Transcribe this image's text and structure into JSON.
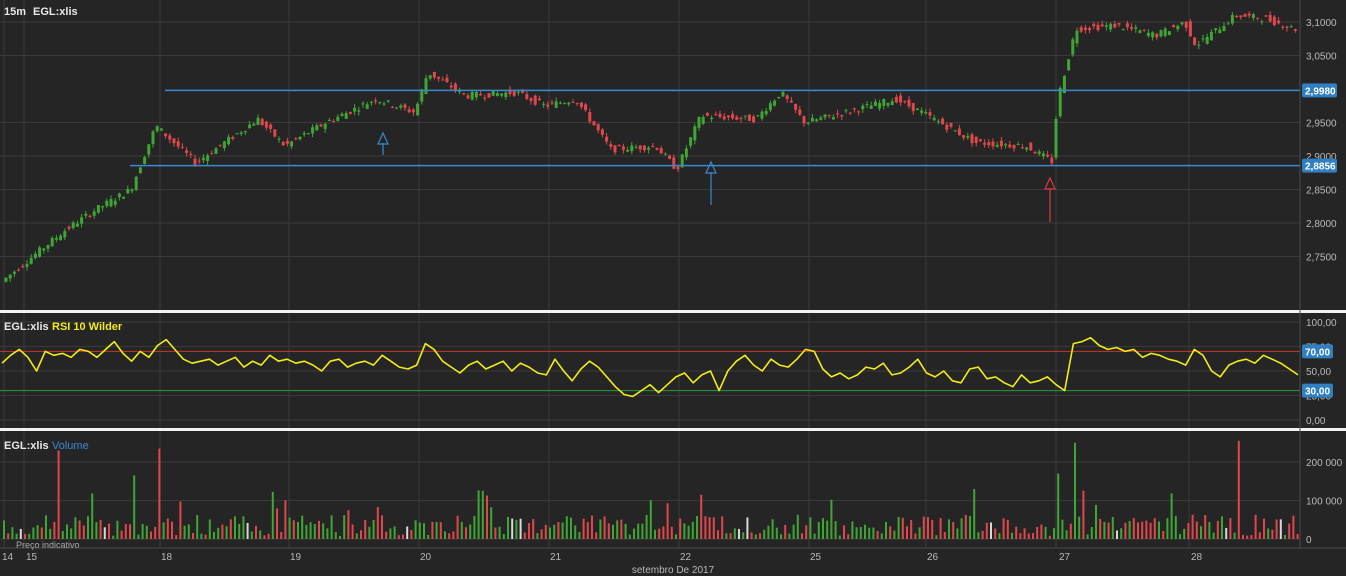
{
  "colors": {
    "background": "#252525",
    "grid": "#3a3a3a",
    "up": "#3fa535",
    "down": "#e0474c",
    "level_line": "#3a8ad0",
    "rsi_line": "#f2ec1a",
    "rsi_upper": "#c0392b",
    "rsi_lower": "#2e9a3a",
    "tag_bg": "#2f7fc1",
    "arrow_blue": "#3a8ad0",
    "arrow_red": "#d53a3a"
  },
  "header": {
    "interval": "15m",
    "symbol": "EGL:xlis"
  },
  "rsi_panel": {
    "symbol": "EGL:xlis",
    "indicator": "RSI 10 Wilder"
  },
  "volume_panel": {
    "symbol": "EGL:xlis",
    "indicator": "Volume"
  },
  "footer_note": "Preço indicativo",
  "x_axis": {
    "title": "setembro De 2017",
    "day_labels": [
      "14",
      "15",
      "18",
      "19",
      "20",
      "21",
      "22",
      "25",
      "26",
      "27",
      "28"
    ]
  },
  "price_axis": {
    "tick_labels": [
      "3,1000",
      "3,0500",
      "2,9500",
      "2,9000",
      "2,8500",
      "2,8000",
      "2,7500"
    ],
    "level_tags": [
      "2,9980",
      "2,8856"
    ]
  },
  "rsi_axis": {
    "tick_labels": [
      "100,00",
      "75,00",
      "50,00",
      "25,00",
      "0,00"
    ],
    "level_tags": [
      "70,00",
      "30,00"
    ]
  },
  "volume_axis": {
    "tick_labels": [
      "200 000",
      "100 000",
      "0"
    ]
  },
  "chart_data": [
    {
      "type": "candlestick",
      "title": "EGL:xlis 15m",
      "ylim": [
        2.7,
        3.12
      ],
      "yticks": [
        3.1,
        3.05,
        2.95,
        2.9,
        2.85,
        2.8,
        2.75
      ],
      "horizontal_levels": [
        2.998,
        2.8856
      ],
      "arrows": [
        {
          "day": "19",
          "direction": "up",
          "color": "blue"
        },
        {
          "day": "22",
          "direction": "up",
          "color": "blue"
        },
        {
          "day": "26",
          "direction": "up",
          "color": "red"
        }
      ],
      "day_close_anchors": [
        {
          "day": "14",
          "close": 2.73
        },
        {
          "day": "15",
          "close": 2.85
        },
        {
          "day": "18",
          "close": 2.935
        },
        {
          "day": "19",
          "close": 2.965
        },
        {
          "day": "20",
          "close": 2.97
        },
        {
          "day": "21",
          "close": 2.91
        },
        {
          "day": "22",
          "close": 2.955
        },
        {
          "day": "25",
          "close": 2.96
        },
        {
          "day": "26",
          "close": 2.895
        },
        {
          "day": "27",
          "close": 3.085
        },
        {
          "day": "28",
          "close": 3.095
        }
      ],
      "series": [
        {
          "name": "EGL:xlis",
          "high_estimate": 3.118,
          "low_estimate": 2.71
        }
      ]
    },
    {
      "type": "line",
      "title": "RSI 10 Wilder",
      "ylim": [
        0,
        100
      ],
      "yticks": [
        100,
        75,
        50,
        25,
        0
      ],
      "horizontal_levels": [
        70,
        30
      ],
      "series": [
        {
          "name": "RSI 10 Wilder",
          "values": [
            58,
            66,
            72,
            64,
            50,
            70,
            66,
            68,
            64,
            72,
            70,
            64,
            72,
            80,
            68,
            60,
            70,
            64,
            76,
            82,
            72,
            62,
            58,
            60,
            62,
            56,
            60,
            64,
            54,
            60,
            56,
            66,
            60,
            62,
            58,
            60,
            56,
            50,
            60,
            62,
            54,
            58,
            60,
            56,
            66,
            60,
            54,
            52,
            56,
            78,
            72,
            60,
            54,
            48,
            56,
            60,
            52,
            56,
            60,
            50,
            58,
            54,
            48,
            46,
            62,
            50,
            40,
            52,
            60,
            54,
            44,
            34,
            26,
            24,
            30,
            36,
            28,
            36,
            44,
            48,
            38,
            46,
            50,
            30,
            50,
            60,
            66,
            56,
            50,
            62,
            56,
            54,
            62,
            72,
            70,
            52,
            44,
            48,
            42,
            46,
            54,
            52,
            58,
            46,
            48,
            54,
            62,
            48,
            44,
            50,
            40,
            38,
            52,
            54,
            42,
            44,
            38,
            34,
            46,
            38,
            40,
            44,
            36,
            30,
            78,
            80,
            84,
            76,
            72,
            74,
            70,
            72,
            64,
            68,
            66,
            62,
            60,
            56,
            72,
            66,
            50,
            44,
            56,
            60,
            62,
            58,
            66,
            62,
            58,
            52,
            46
          ]
        }
      ]
    },
    {
      "type": "bar",
      "title": "Volume",
      "ylim": [
        0,
        260000
      ],
      "yticks": [
        200000,
        100000,
        0
      ],
      "spikes": [
        {
          "day": "15",
          "value": 230000
        },
        {
          "day": "18",
          "value": 165000
        },
        {
          "day": "18",
          "value": 235000
        },
        {
          "day": "27",
          "value": 170000
        },
        {
          "day": "27",
          "value": 250000
        },
        {
          "day": "28",
          "value": 255000
        }
      ],
      "typical_value": 40000
    }
  ]
}
